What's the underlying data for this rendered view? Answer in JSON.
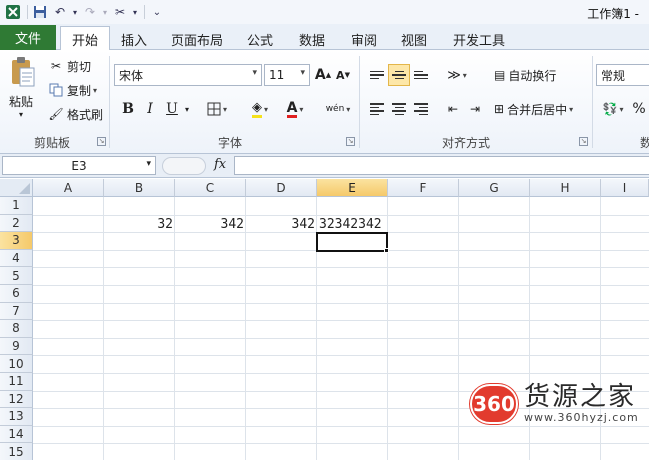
{
  "window": {
    "title": "工作簿1 -"
  },
  "ribbon": {
    "tabs": [
      "文件",
      "开始",
      "插入",
      "页面布局",
      "公式",
      "数据",
      "审阅",
      "视图",
      "开发工具"
    ],
    "active_tab": "开始",
    "clipboard": {
      "paste": "粘贴",
      "cut": "剪切",
      "copy": "复制",
      "format_painter": "格式刷",
      "group": "剪贴板"
    },
    "font": {
      "name": "宋体",
      "size": "11",
      "group": "字体",
      "bold": "B",
      "italic": "I",
      "underline": "U",
      "grow": "A",
      "shrink": "A",
      "font_color": "A",
      "phonetic": "wén"
    },
    "alignment": {
      "wrap": "自动换行",
      "merge": "合并后居中",
      "group": "对齐方式"
    },
    "number": {
      "format": "常规",
      "group": "数",
      "percent": "%"
    }
  },
  "formula_bar": {
    "name_box": "E3",
    "fx": "fx",
    "value": ""
  },
  "grid": {
    "columns": [
      "A",
      "B",
      "C",
      "D",
      "E",
      "F",
      "G",
      "H",
      "I"
    ],
    "rows": [
      "1",
      "2",
      "3",
      "4",
      "5",
      "6",
      "7",
      "8",
      "9",
      "10",
      "11",
      "12",
      "13",
      "14",
      "15"
    ],
    "selected_column": "E",
    "selected_row": "3",
    "cells": {
      "B2": "32",
      "C2": "342",
      "D2": "342",
      "E2": "32342342"
    }
  },
  "watermark": {
    "badge": "360",
    "name": "货源之家",
    "url": "www.360hyzj.com"
  },
  "colors": {
    "file_tab": "#2f7a34",
    "selection_header": "#f5c96a",
    "watermark": "#e23b2e"
  }
}
